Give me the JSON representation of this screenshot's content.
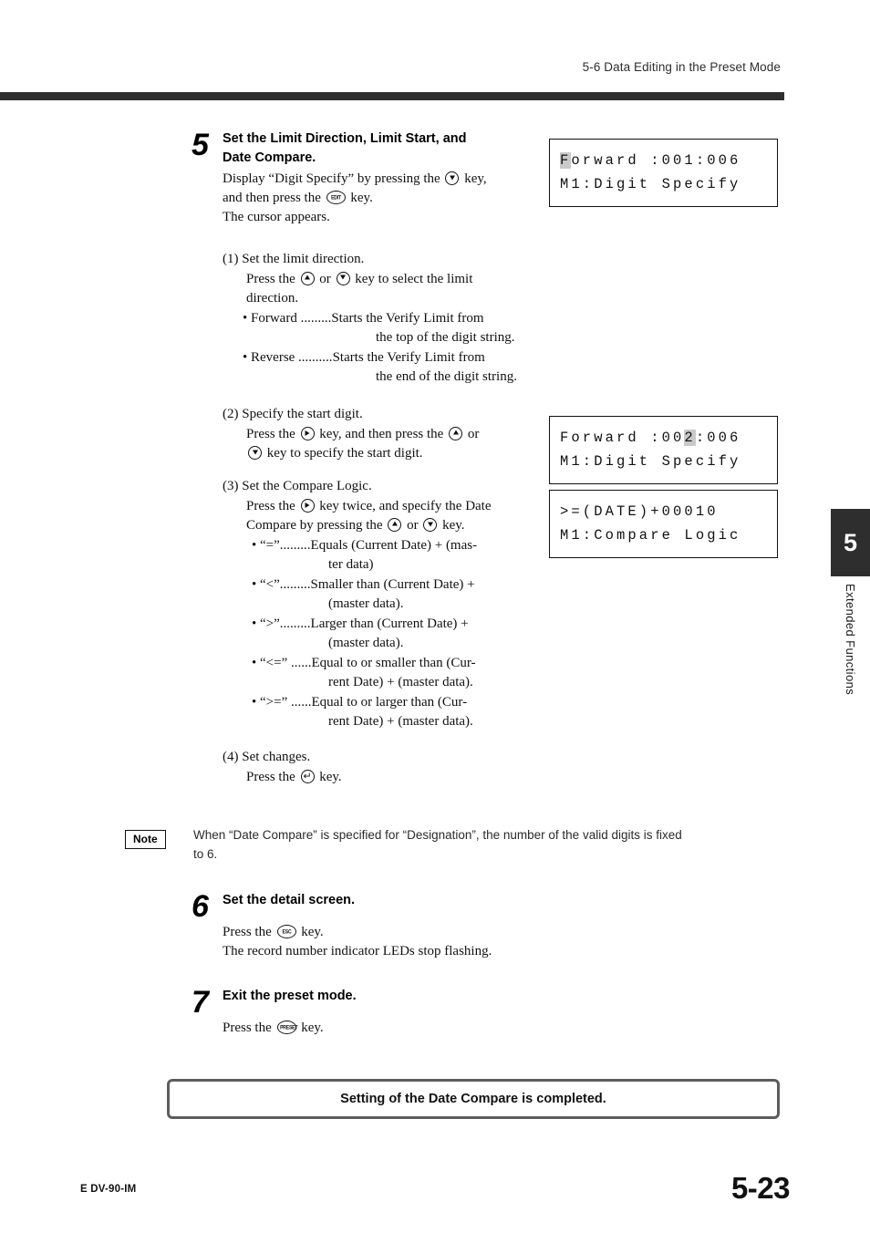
{
  "header": {
    "section_title": "5-6  Data Editing in the Preset Mode"
  },
  "side_tab": {
    "chapter_number": "5",
    "chapter_label": "Extended Functions"
  },
  "steps": [
    {
      "number": "5",
      "heading_line1": "Set the Limit Direction, Limit Start, and",
      "heading_line2": "Date Compare.",
      "body_line1_a": "Display “Digit Specify” by pressing the",
      "body_line1_b": "key,",
      "body_line2_a": "and then press the",
      "body_line2_b": "key.",
      "body_line3": "The cursor appears.",
      "substeps": [
        {
          "label": "(1) Set the limit direction.",
          "instr_a": "Press the",
          "instr_or": "or",
          "instr_b": "key to select the limit",
          "instr_c": "direction.",
          "bullets": [
            {
              "term": "Forward .........",
              "desc": "Starts the Verify Limit from",
              "cont": "the top of the digit string."
            },
            {
              "term": "Reverse ..........",
              "desc": "Starts the Verify Limit from",
              "cont": "the end of the digit string."
            }
          ]
        },
        {
          "label": "(2) Specify the start digit.",
          "instr_a": "Press the",
          "instr_b": "key, and then press the",
          "instr_or": "or",
          "instr_c": "key to specify the start digit."
        },
        {
          "label": "(3) Set the Compare Logic.",
          "instr_a": "Press the",
          "instr_b": "key twice, and specify the Date",
          "instr_c": "Compare by pressing the",
          "instr_or": "or",
          "instr_d": "key.",
          "bullets": [
            {
              "term": "“=”.........",
              "desc": "Equals (Current Date) + (mas-",
              "cont": "ter data)"
            },
            {
              "term": "“<”.........",
              "desc": "Smaller than (Current Date) +",
              "cont": "(master data)."
            },
            {
              "term": "“>”.........",
              "desc": "Larger than (Current Date) +",
              "cont": "(master data)."
            },
            {
              "term": "“<=” ......",
              "desc": "Equal to or smaller than (Cur-",
              "cont": "rent Date) + (master data)."
            },
            {
              "term": "“>=” ......",
              "desc": "Equal to or larger than (Cur-",
              "cont": "rent Date) + (master data)."
            }
          ]
        },
        {
          "label": "(4) Set changes.",
          "instr_a": "Press the",
          "instr_b": "key."
        }
      ]
    },
    {
      "number": "6",
      "heading_line1": "Set the detail screen.",
      "body_line1_a": "Press the",
      "body_line1_b": "key.",
      "body_line2": "The record number indicator LEDs stop flashing."
    },
    {
      "number": "7",
      "heading_line1": "Exit the preset mode.",
      "body_line1_a": "Press the",
      "body_line1_b": "key."
    }
  ],
  "key_icons": {
    "down": "down-arrow-key",
    "up": "up-arrow-key",
    "right": "right-arrow-key",
    "edit": "EDIT",
    "esc": "ESC",
    "preset": "PRESET",
    "enter": "↵"
  },
  "lcd_displays": [
    {
      "name": "lcd-digit-specify-001",
      "line1_pre": "",
      "line1_hl": "F",
      "line1_post": "orward :001:006",
      "line2": "M1:Digit Specify"
    },
    {
      "name": "lcd-digit-specify-002",
      "line1_pre": "Forward :00",
      "line1_hl": "2",
      "line1_post": ":006",
      "line2": "M1:Digit Specify"
    },
    {
      "name": "lcd-compare-logic",
      "line1_pre": ">=(DATE)+00010",
      "line1_hl": "",
      "line1_post": "",
      "line2": "M1:Compare Logic"
    }
  ],
  "note": {
    "badge": "Note",
    "text_line1": "When “Date Compare” is specified for “Designation”, the number of the valid digits is fixed",
    "text_line2": "to 6."
  },
  "completion": {
    "message": "Setting of the Date Compare is completed."
  },
  "footer": {
    "document_code": "E DV-90-IM",
    "page_number": "5-23"
  }
}
